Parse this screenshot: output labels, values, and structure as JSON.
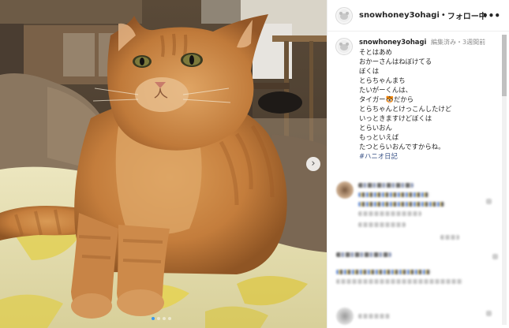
{
  "post": {
    "username": "snowhoney3ohagi",
    "separator": "•",
    "follow_label": "フォロー中",
    "more_icon": "more-dots-icon",
    "caption": {
      "username": "snowhoney3ohagi",
      "edited": "編集済み",
      "meta_sep": "・",
      "time_ago": "3週間前",
      "lines": [
        "そとはあめ",
        "おかーさんはねぼけてる",
        "ぼくは",
        "とらちゃんまち",
        "たいがーくんは、",
        "タイガー🐯だから",
        "とらちゃんとけっこんしたけど",
        "いっときますけどぼくは",
        "とらいおん",
        "もっといえば",
        "たつとらいおんですからね。"
      ],
      "hashtag": "#ハニオ日記"
    },
    "carousel": {
      "next_icon": "›",
      "slides": 4,
      "active_slide": 1
    }
  },
  "colors": {
    "hashtag": "#385185",
    "active_dot": "#3a97ee",
    "follow": "#262626"
  }
}
